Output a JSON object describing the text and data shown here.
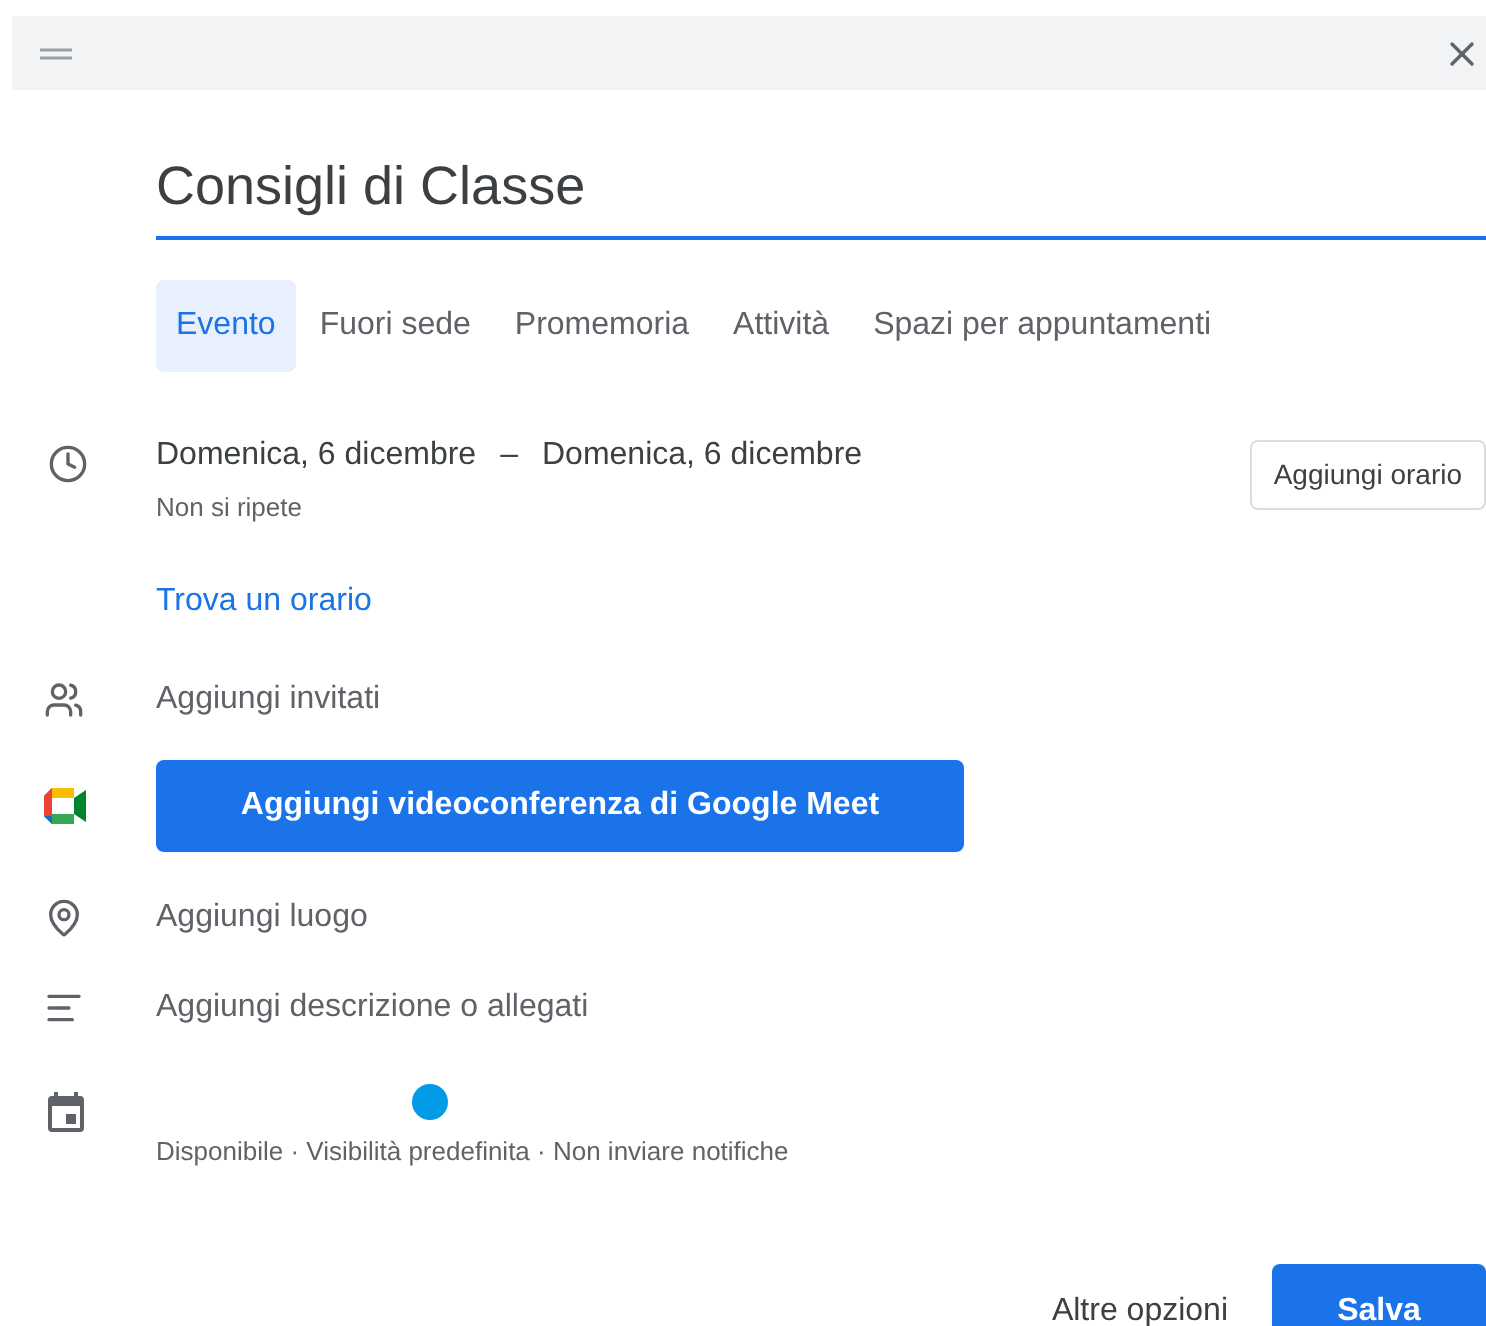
{
  "title": {
    "value": "Consigli di Classe"
  },
  "tabs": [
    {
      "label": "Evento",
      "selected": true
    },
    {
      "label": "Fuori sede",
      "selected": false
    },
    {
      "label": "Promemoria",
      "selected": false
    },
    {
      "label": "Attività",
      "selected": false
    },
    {
      "label": "Spazi per appuntamenti",
      "selected": false
    }
  ],
  "date": {
    "start": "Domenica, 6 dicembre",
    "separator": "–",
    "end": "Domenica, 6 dicembre",
    "recurrence": "Non si ripete",
    "add_time_button": "Aggiungi orario"
  },
  "find_time_link": "Trova un orario",
  "guests": {
    "placeholder": "Aggiungi invitati"
  },
  "meet_button": "Aggiungi videoconferenza di Google Meet",
  "location": {
    "placeholder": "Aggiungi luogo"
  },
  "description": {
    "placeholder": "Aggiungi descrizione o allegati"
  },
  "calendar": {
    "color": "#039be5",
    "details": "Disponibile · Visibilità predefinita · Non inviare notifiche"
  },
  "footer": {
    "more_options": "Altre opzioni",
    "save": "Salva"
  }
}
